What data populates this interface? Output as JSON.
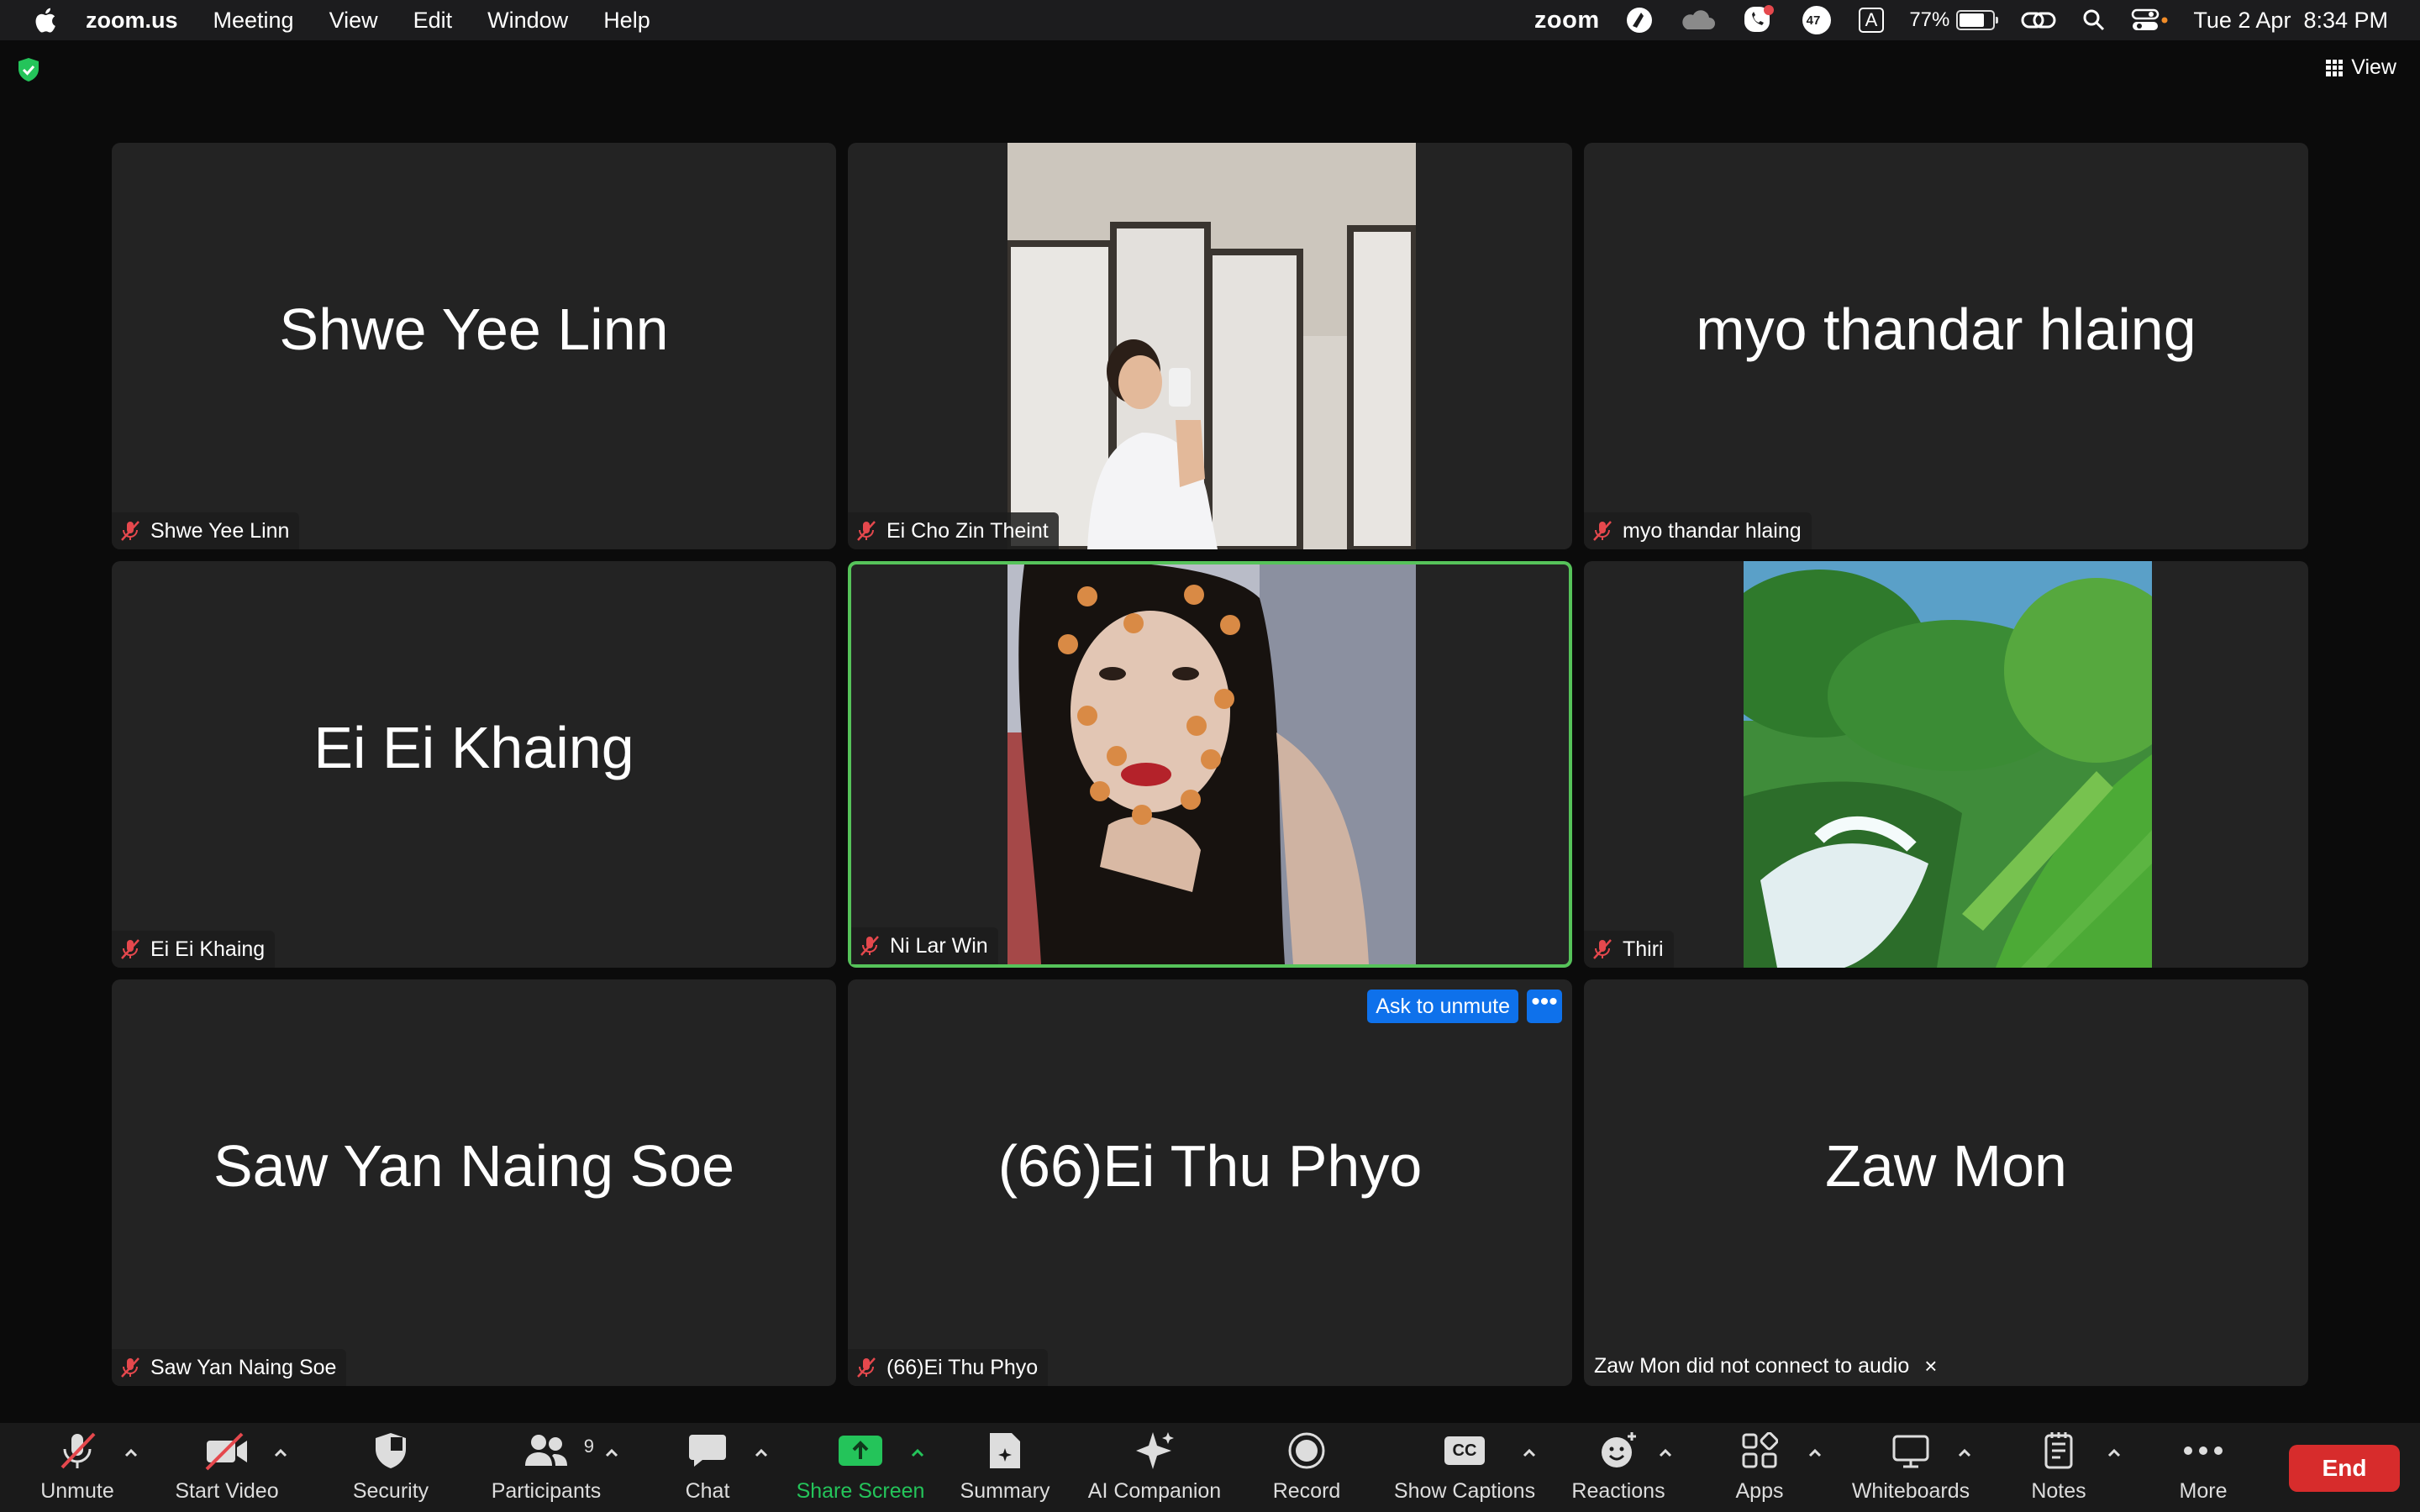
{
  "menubar": {
    "app": "zoom.us",
    "items": [
      "Meeting",
      "View",
      "Edit",
      "Window",
      "Help"
    ],
    "zoom_logo": "zoom",
    "badge_count": "47",
    "input_source": "A",
    "battery": "77%",
    "battery_level": 0.77,
    "datetime": "Tue 2 Apr  8:34 PM"
  },
  "view_button": "View",
  "tiles": [
    {
      "display": "Shwe Yee Linn",
      "label": "Shwe Yee Linn"
    },
    {
      "display": "",
      "label": "Ei Cho Zin Theint"
    },
    {
      "display": "myo thandar hlaing",
      "label": "myo thandar hlaing"
    },
    {
      "display": "Ei Ei Khaing",
      "label": "Ei Ei Khaing"
    },
    {
      "display": "",
      "label": "Ni Lar Win"
    },
    {
      "display": "",
      "label": "Thiri"
    },
    {
      "display": "Saw Yan Naing Soe",
      "label": "Saw Yan Naing Soe"
    },
    {
      "display": "(66)Ei Thu Phyo",
      "label": "(66)Ei Thu Phyo",
      "ask_unmute": "Ask to unmute",
      "more": "•••"
    },
    {
      "display": "Zaw Mon",
      "notice": "Zaw Mon did not connect to audio",
      "close": "×"
    }
  ],
  "toolbar": {
    "unmute": "Unmute",
    "start_video": "Start Video",
    "security": "Security",
    "participants": "Participants",
    "participants_count": "9",
    "chat": "Chat",
    "share_screen": "Share Screen",
    "summary": "Summary",
    "ai_companion": "AI Companion",
    "record": "Record",
    "show_captions": "Show Captions",
    "captions_icon_text": "CC",
    "reactions": "Reactions",
    "apps": "Apps",
    "whiteboards": "Whiteboards",
    "notes": "Notes",
    "more": "More",
    "end": "End"
  },
  "colors": {
    "active_border": "#56c35a",
    "share_green": "#24c45a",
    "end_red": "#d72c2c",
    "ask_blue": "#0e71eb",
    "muted_red": "#e5484d"
  }
}
